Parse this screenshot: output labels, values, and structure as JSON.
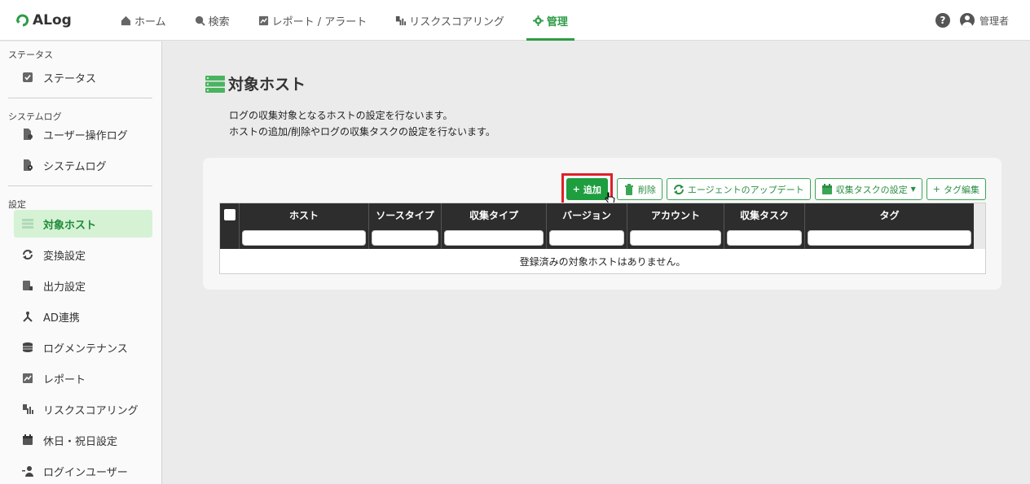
{
  "app": {
    "logo_text": "ALog"
  },
  "nav": [
    {
      "label": "ホーム",
      "icon": "home-icon",
      "active": false
    },
    {
      "label": "検索",
      "icon": "search-icon",
      "active": false
    },
    {
      "label": "レポート / アラート",
      "icon": "report-icon",
      "active": false
    },
    {
      "label": "リスクスコアリング",
      "icon": "risk-icon",
      "active": false
    },
    {
      "label": "管理",
      "icon": "gear-icon",
      "active": true
    }
  ],
  "header": {
    "user_name": "管理者",
    "help": "?"
  },
  "sidebar": {
    "sections": [
      {
        "title": "ステータス",
        "items": [
          {
            "label": "ステータス",
            "icon": "check-icon"
          }
        ]
      },
      {
        "title": "システムログ",
        "items": [
          {
            "label": "ユーザー操作ログ",
            "icon": "file-user-icon"
          },
          {
            "label": "システムログ",
            "icon": "file-gear-icon"
          }
        ]
      },
      {
        "title": "設定",
        "items": [
          {
            "label": "対象ホスト",
            "icon": "server-list-icon",
            "active": true
          },
          {
            "label": "変換設定",
            "icon": "sync-icon"
          },
          {
            "label": "出力設定",
            "icon": "output-icon"
          },
          {
            "label": "AD連携",
            "icon": "network-icon"
          },
          {
            "label": "ログメンテナンス",
            "icon": "database-icon"
          },
          {
            "label": "レポート",
            "icon": "report-icon"
          },
          {
            "label": "リスクスコアリング",
            "icon": "risk-icon"
          },
          {
            "label": "休日・祝日設定",
            "icon": "calendar-icon"
          },
          {
            "label": "ログインユーザー",
            "icon": "user-add-icon"
          }
        ]
      }
    ]
  },
  "page": {
    "title": "対象ホスト",
    "description": [
      "ログの収集対象となるホストの設定を行ないます。",
      "ホストの追加/削除やログの収集タスクの設定を行ないます。"
    ]
  },
  "toolbar": {
    "add": "追加",
    "delete": "削除",
    "agent_update": "エージェントのアップデート",
    "task_settings": "収集タスクの設定",
    "tag_edit": "タグ編集"
  },
  "table": {
    "columns": [
      "ホスト",
      "ソースタイプ",
      "収集タイプ",
      "バージョン",
      "アカウント",
      "収集タスク",
      "タグ"
    ],
    "empty_message": "登録済みの対象ホストはありません。"
  },
  "colors": {
    "accent": "#2e9c47",
    "highlight": "#e0202a",
    "header_dark": "#2d2d2d"
  }
}
